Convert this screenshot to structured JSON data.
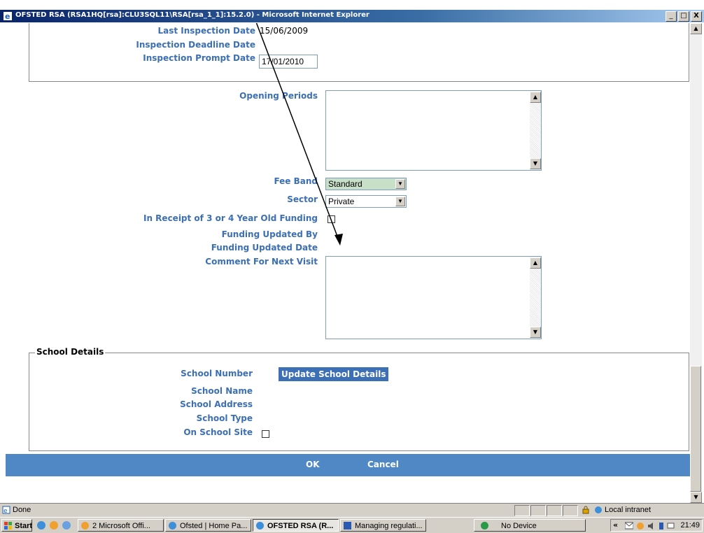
{
  "window": {
    "title": "OFSTED RSA (RSA1HQ[rsa]:CLU3SQL11\\RSA[rsa_1_1]:15.2.0) - Microsoft Internet Explorer",
    "minimize": "_",
    "maximize": "□",
    "close": "X"
  },
  "inspection": {
    "last_inspection_label": "Last Inspection Date",
    "last_inspection_value": "15/06/2009",
    "deadline_label": "Inspection Deadline Date",
    "prompt_label": "Inspection Prompt Date",
    "prompt_value": "17/01/2010"
  },
  "details": {
    "opening_periods_label": "Opening Periods",
    "fee_band_label": "Fee Band",
    "fee_band_value": "Standard",
    "sector_label": "Sector",
    "sector_value": "Private",
    "funding_label": "In Receipt of 3 or 4 Year Old Funding",
    "funding_updated_by_label": "Funding Updated By",
    "funding_updated_date_label": "Funding Updated Date",
    "comment_label": "Comment For Next Visit"
  },
  "school": {
    "legend": "School Details",
    "number_label": "School Number",
    "update_button": "Update School Details",
    "name_label": "School Name",
    "address_label": "School Address",
    "type_label": "School Type",
    "on_site_label": "On School Site"
  },
  "actions": {
    "ok": "OK",
    "cancel": "Cancel"
  },
  "status": {
    "text": "Done",
    "zone": "Local intranet"
  },
  "taskbar": {
    "start": "Start",
    "items": [
      "2 Microsoft Offi...",
      "Ofsted | Home Pa...",
      "OFSTED RSA (R...",
      "Managing regulati...",
      "No Device"
    ],
    "clock": "21:49"
  },
  "colors": {
    "label_blue": "#3c6fb4",
    "action_bar": "#4f88c4",
    "fee_band_bg": "#c8e0c8"
  }
}
